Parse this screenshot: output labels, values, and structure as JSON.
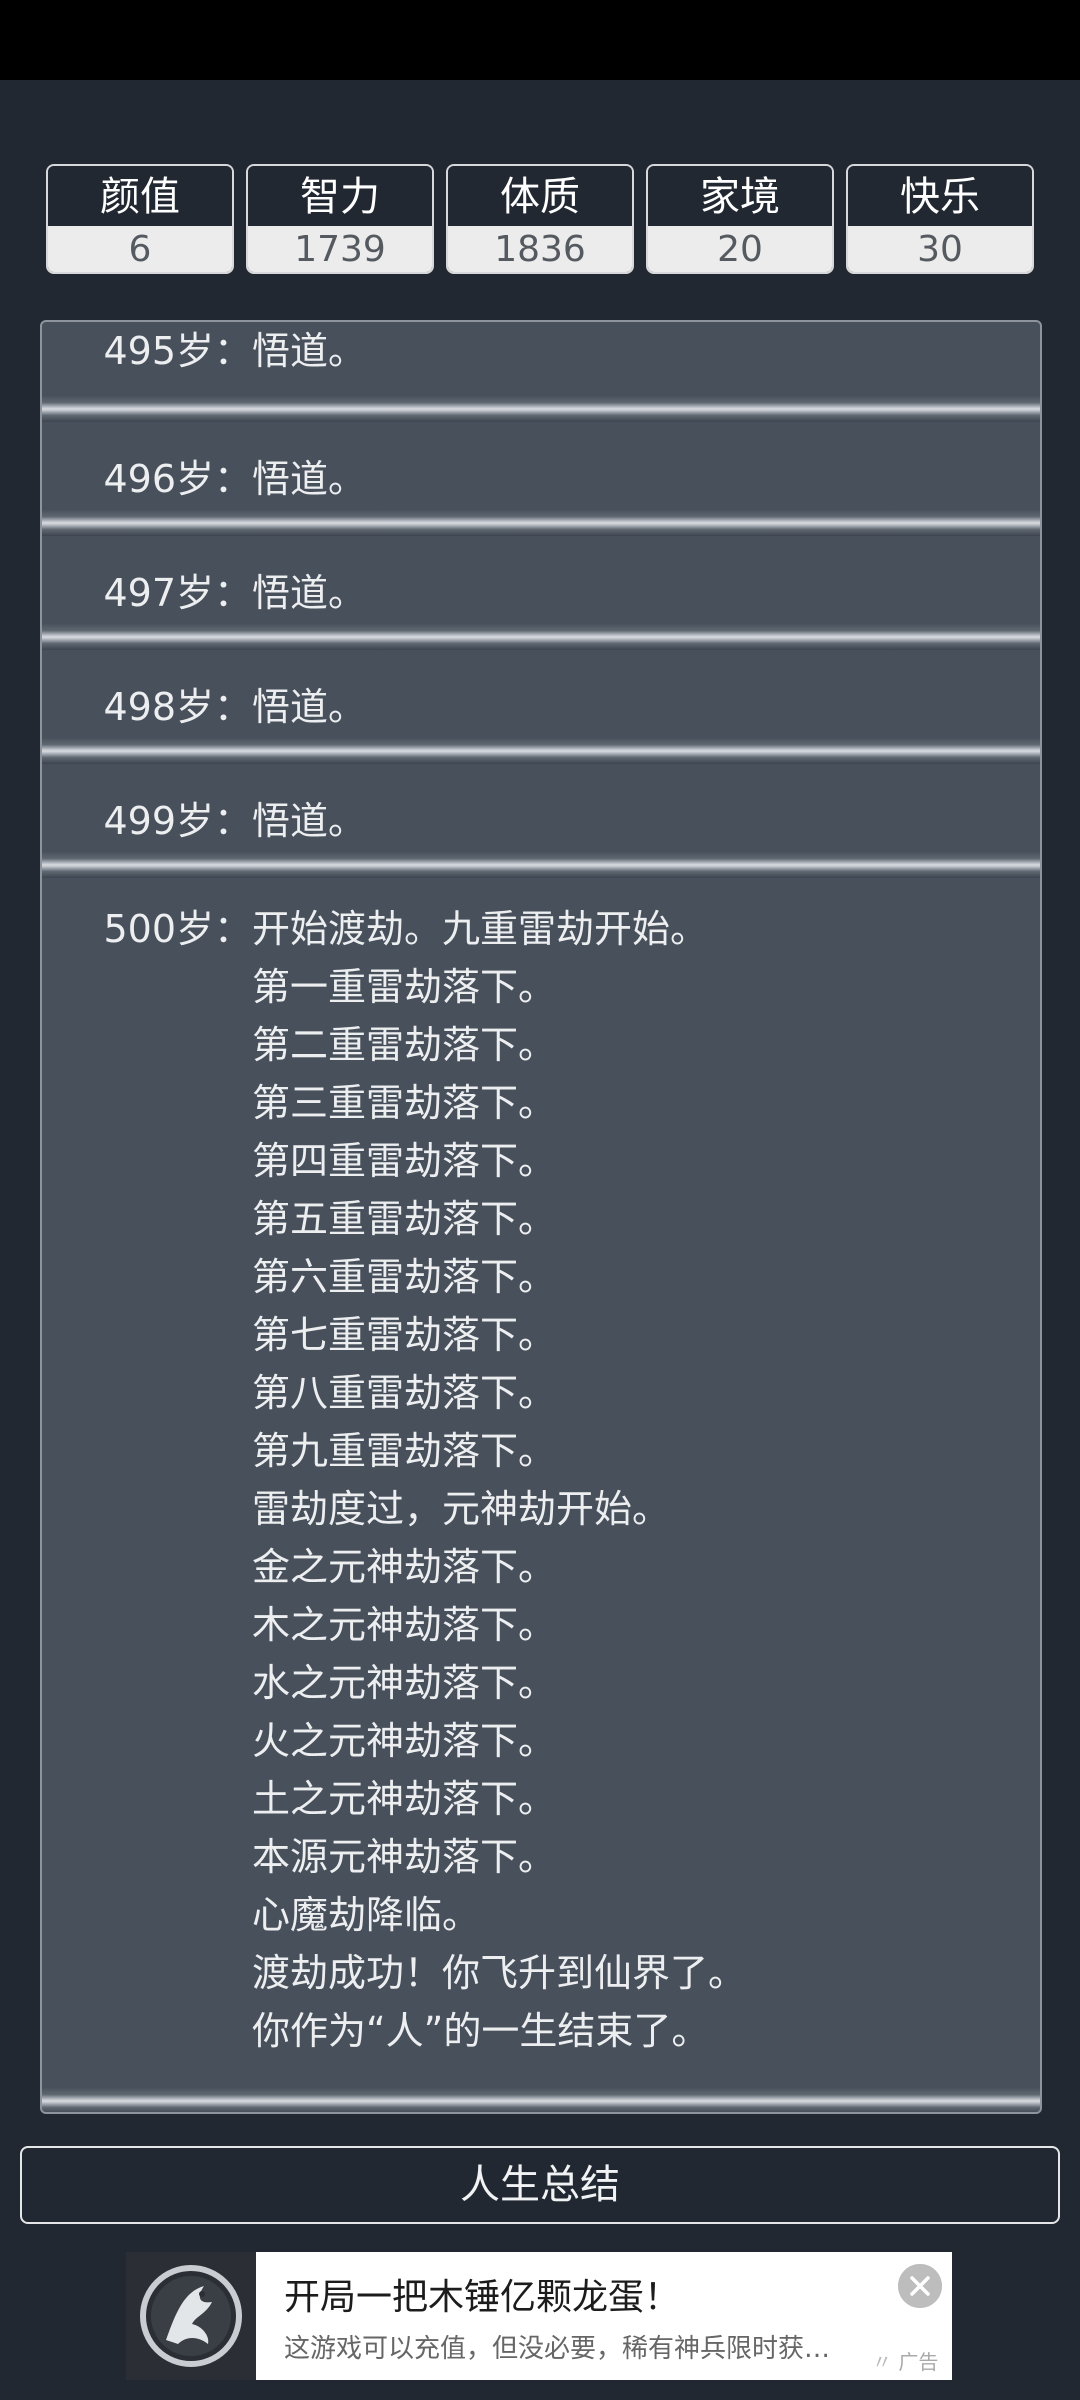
{
  "stats": [
    {
      "label": "颜值",
      "value": "6"
    },
    {
      "label": "智力",
      "value": "1739"
    },
    {
      "label": "体质",
      "value": "1836"
    },
    {
      "label": "家境",
      "value": "20"
    },
    {
      "label": "快乐",
      "value": "30"
    }
  ],
  "log": [
    {
      "age": "495岁：",
      "lines": [
        "悟道。"
      ]
    },
    {
      "age": "496岁：",
      "lines": [
        "悟道。"
      ]
    },
    {
      "age": "497岁：",
      "lines": [
        "悟道。"
      ]
    },
    {
      "age": "498岁：",
      "lines": [
        "悟道。"
      ]
    },
    {
      "age": "499岁：",
      "lines": [
        "悟道。"
      ]
    },
    {
      "age": "500岁：",
      "lines": [
        "开始渡劫。九重雷劫开始。",
        "第一重雷劫落下。",
        "第二重雷劫落下。",
        "第三重雷劫落下。",
        "第四重雷劫落下。",
        "第五重雷劫落下。",
        "第六重雷劫落下。",
        "第七重雷劫落下。",
        "第八重雷劫落下。",
        "第九重雷劫落下。",
        "雷劫度过，元神劫开始。",
        "金之元神劫落下。",
        "木之元神劫落下。",
        "水之元神劫落下。",
        "火之元神劫落下。",
        "土之元神劫落下。",
        "本源元神劫落下。",
        "心魔劫降临。",
        "渡劫成功！你飞升到仙界了。",
        "你作为“人”的一生结束了。"
      ]
    }
  ],
  "summary_button": "人生总结",
  "ad": {
    "title": "开局一把木锤亿颗龙蛋！",
    "description": "这游戏可以充值，但没必要，稀有神兵限时获…",
    "tag": "广告",
    "logo_icon": "dragon-logo-icon",
    "close_icon": "close-icon"
  }
}
